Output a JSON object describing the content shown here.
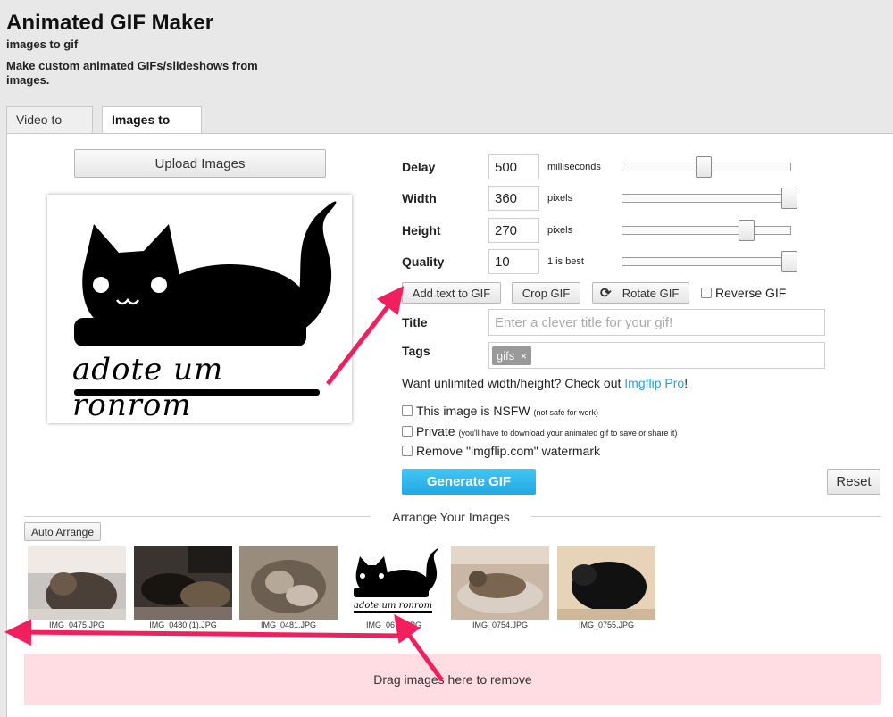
{
  "header": {
    "title": "Animated GIF Maker",
    "subtitle": "images to gif",
    "description": "Make custom animated GIFs/slideshows from images."
  },
  "tabs": [
    {
      "label": "Video to GIF",
      "active": false
    },
    {
      "label": "Images to GIF",
      "active": true
    }
  ],
  "upload_button": "Upload Images",
  "preview": {
    "caption": "adote um ronrom"
  },
  "settings": {
    "delay": {
      "label": "Delay",
      "value": "500",
      "unit": "milliseconds",
      "slider_fraction": 0.49
    },
    "width": {
      "label": "Width",
      "value": "360",
      "unit": "pixels",
      "slider_fraction": 1.0
    },
    "height": {
      "label": "Height",
      "value": "270",
      "unit": "pixels",
      "slider_fraction": 0.74
    },
    "quality": {
      "label": "Quality",
      "value": "10",
      "unit": "1 is best",
      "slider_fraction": 1.0
    }
  },
  "actions": {
    "add_text": "Add text to GIF",
    "crop": "Crop GIF",
    "rotate": "Rotate GIF",
    "reverse": "Reverse GIF"
  },
  "title_field": {
    "label": "Title",
    "placeholder": "Enter a clever title for your gif!"
  },
  "tags_field": {
    "label": "Tags",
    "tag": "gifs",
    "remove_glyph": "×"
  },
  "promo": {
    "text": "Want unlimited width/height? Check out ",
    "link": "Imgflip Pro",
    "suffix": "!"
  },
  "options": {
    "nsfw": {
      "label": "This image is NSFW",
      "note": "(not safe for work)"
    },
    "private": {
      "label": "Private",
      "note": "(you'll have to download your animated gif to save or share it)"
    },
    "watermark": {
      "label": "Remove \"imgflip.com\" watermark"
    }
  },
  "generate_button": "Generate GIF",
  "reset_button": "Reset",
  "arrange": {
    "heading": "Arrange Your Images",
    "auto_button": "Auto Arrange",
    "images": [
      {
        "name": "IMG_0475.JPG"
      },
      {
        "name": "IMG_0480 (1).JPG"
      },
      {
        "name": "IMG_0481.JPG"
      },
      {
        "name": "IMG_0675.JPG"
      },
      {
        "name": "IMG_0754.JPG"
      },
      {
        "name": "IMG_0755.JPG"
      }
    ]
  },
  "drop_zone": "Drag images here to remove",
  "colors": {
    "accent": "#2fb3ea",
    "link": "#2a9fd6",
    "annotation": "#f0205e",
    "drop_zone": "#ffdde2"
  },
  "icons": {
    "rotate": "rotate-icon",
    "cat_logo": "cat-logo-icon"
  }
}
